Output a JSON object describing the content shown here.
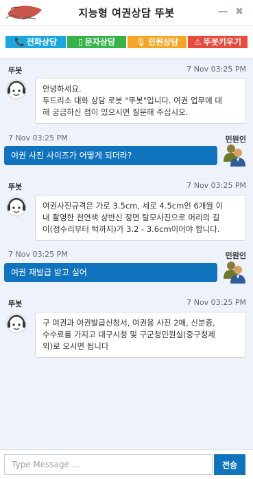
{
  "window": {
    "title": "지능형 여권상담 뚜봇",
    "minimize_icon": "minimize-icon",
    "close_icon": "close-icon"
  },
  "logo": {
    "icon": "handwritten-signature-logo",
    "color": "#c0392b"
  },
  "tabs": [
    {
      "label": "전화상담",
      "icon": "phone-icon",
      "glyph": "📞",
      "color": "#19a7e0"
    },
    {
      "label": "문자상담",
      "icon": "mobile-icon",
      "glyph": "▯",
      "color": "#37b34a"
    },
    {
      "label": "민원상담",
      "icon": "microphone-icon",
      "glyph": "🎙",
      "color": "#f5a623"
    },
    {
      "label": "뚜봇키우기",
      "icon": "warning-icon",
      "glyph": "⚠",
      "color": "#e84b3c"
    }
  ],
  "messages": [
    {
      "role": "bot",
      "sender": "뚜봇",
      "timestamp": "7 Nov 03:25 PM",
      "lines": [
        "안녕하세요.",
        "두드리소 대화 상담 로봇 \"뚜봇\"입니다. 여권 업무에 대",
        "해 궁금하신 점이 있으시면 질문해 주십시오."
      ]
    },
    {
      "role": "user",
      "sender": "민원인",
      "timestamp": "7 Nov 03:25 PM",
      "text": "여권 사진 사이즈가 어떻게 되더라?"
    },
    {
      "role": "bot",
      "sender": "뚜봇",
      "timestamp": "7 Nov 03:25 PM",
      "lines": [
        "여권사진규격은 가로 3.5cm, 세로 4.5cm인 6개월 이",
        "내 촬영한 천연색 상반신 정면 탈모사진으로 머리의 길",
        "이(정수리부터 턱까지)가 3.2 - 3.6cm이어야 합니다."
      ]
    },
    {
      "role": "user",
      "sender": "민원인",
      "timestamp": "7 Nov 03:25 PM",
      "text": "여권 재발급 받고 싶어"
    },
    {
      "role": "bot",
      "sender": "뚜봇",
      "timestamp": "7 Nov 03:25 PM",
      "lines": [
        "구 여권과 여권발급신청서, 여권용 사진 2매, 신분증,",
        "수수료를 가지고 대구시청 및 구군청민원실(중구청제",
        "외)로 오시면 됩니다"
      ]
    }
  ],
  "input": {
    "placeholder": "Type Message ...",
    "value": "",
    "send_label": "전송"
  },
  "colors": {
    "user_bubble": "#1073be",
    "background": "#eef2fb"
  }
}
